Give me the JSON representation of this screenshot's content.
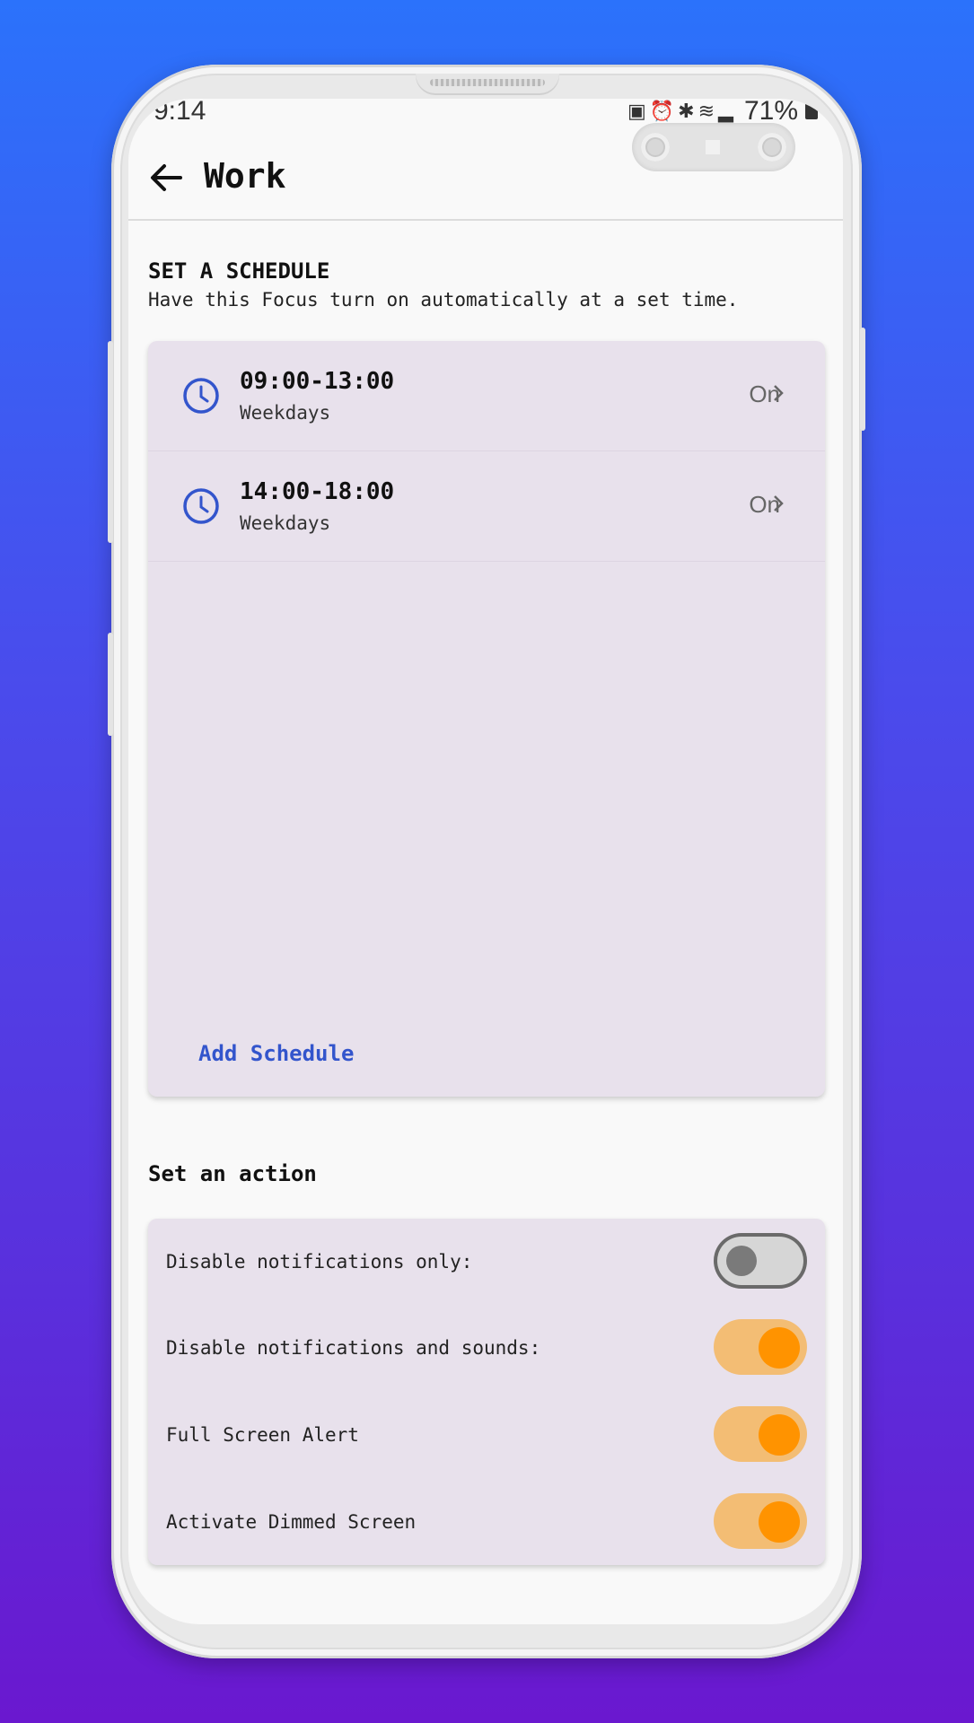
{
  "status_bar": {
    "time": "9:14",
    "battery": "71%"
  },
  "header": {
    "title": "Work"
  },
  "schedule_section": {
    "title": "SET A SCHEDULE",
    "subtitle": "Have this Focus turn on automatically at a set time.",
    "items": [
      {
        "time": "09:00-13:00",
        "days": "Weekdays",
        "status": "On"
      },
      {
        "time": "14:00-18:00",
        "days": "Weekdays",
        "status": "On"
      }
    ],
    "add_label": "Add Schedule"
  },
  "action_section": {
    "title": "Set an action",
    "items": [
      {
        "label": "Disable notifications only:",
        "enabled": false
      },
      {
        "label": "Disable notifications and sounds:",
        "enabled": true
      },
      {
        "label": "Full Screen Alert",
        "enabled": true
      },
      {
        "label": "Activate Dimmed Screen",
        "enabled": true
      }
    ]
  },
  "colors": {
    "accent": "#3355cc",
    "toggle_on_track": "#f3bd74",
    "toggle_on_knob": "#ff9300",
    "card_bg": "#e8e1ec"
  }
}
